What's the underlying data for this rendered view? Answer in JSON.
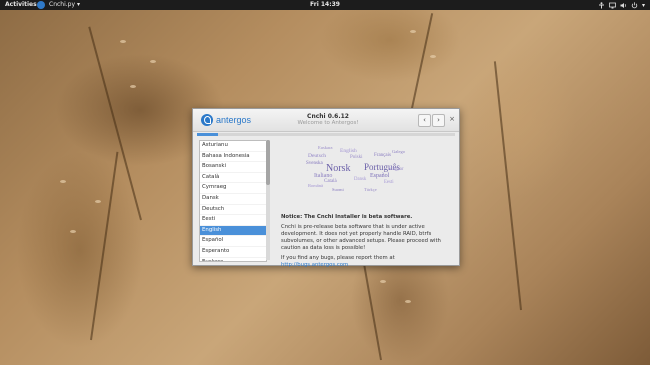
{
  "topbar": {
    "activities": "Activities",
    "app_name": "Cnchi.py",
    "app_arrow": "▾",
    "clock": "Fri 14:39"
  },
  "window": {
    "logo_text": "antergos",
    "title": "Cnchi 0.6.12",
    "subtitle": "Welcome to Antergos!",
    "back": "‹",
    "forward": "›",
    "close": "×",
    "progress": 0.08
  },
  "languages": {
    "items": [
      "Asturianu",
      "Bahasa Indonesia",
      "Bosanski",
      "Català",
      "Cymraeg",
      "Dansk",
      "Deutsch",
      "Eesti",
      "English",
      "Español",
      "Esperanto",
      "Euskara",
      "Français"
    ],
    "selected": "English"
  },
  "wordcloud": [
    {
      "text": "Norsk",
      "color": "#6a5fa8"
    },
    {
      "text": "Português",
      "color": "#6a5fa8"
    },
    {
      "text": "Italiano",
      "color": "#8a7dc0"
    },
    {
      "text": "Español",
      "color": "#7b6fb8"
    },
    {
      "text": "Deutsch",
      "color": "#9285c7"
    },
    {
      "text": "English",
      "color": "#a294d3"
    },
    {
      "text": "Français",
      "color": "#8a7dc0"
    },
    {
      "text": "Polski",
      "color": "#9a8dc9"
    },
    {
      "text": "Svenska",
      "color": "#8376bd"
    },
    {
      "text": "Magyar",
      "color": "#a094cd"
    },
    {
      "text": "Català",
      "color": "#9285c7"
    },
    {
      "text": "Dansk",
      "color": "#a89bd6"
    },
    {
      "text": "Eesti",
      "color": "#a89bd6"
    },
    {
      "text": "Suomi",
      "color": "#8a7dc0"
    },
    {
      "text": "Türkçe",
      "color": "#9a8dc9"
    },
    {
      "text": "Română",
      "color": "#a294d3"
    },
    {
      "text": "Galego",
      "color": "#8f82c4"
    },
    {
      "text": "Euskara",
      "color": "#9a8dc9"
    }
  ],
  "notice": {
    "heading": "Notice: The Cnchi Installer is beta software.",
    "body": "Cnchi is pre-release beta software that is under active development. It does not yet properly handle RAID, btrfs subvolumes, or other advanced setups. Please proceed with caution as data loss is possible!",
    "bugs_prefix": "If you find any bugs, please report them at ",
    "bugs_link": "http://bugs.antergos.com"
  }
}
